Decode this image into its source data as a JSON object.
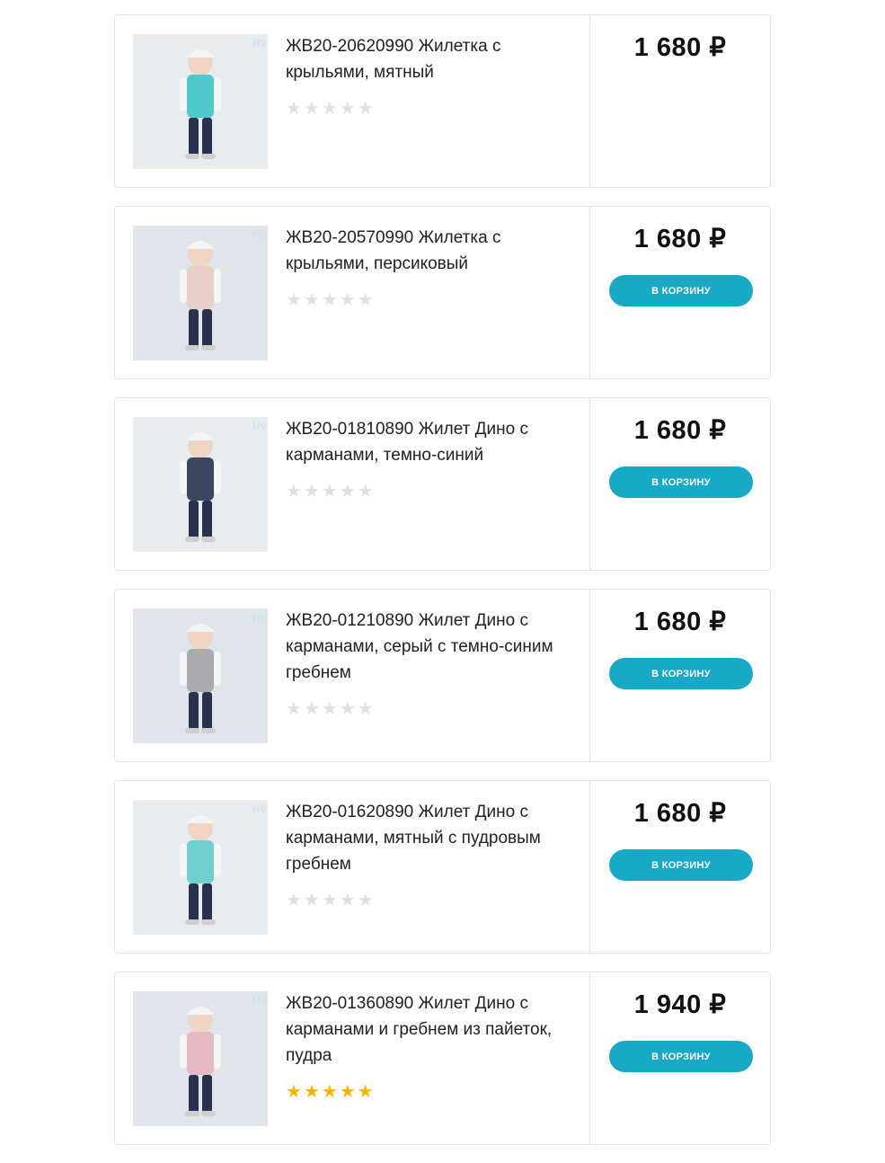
{
  "products": [
    {
      "title": "ЖВ20-20620990 Жилетка с крыльями, мятный",
      "price": "1 680 ₽",
      "rating": 0,
      "has_cart": false,
      "vest_color": "#4fc9cc",
      "image_theme": "mint-winged-vest"
    },
    {
      "title": "ЖВ20-20570990 Жилетка с крыльями, персиковый",
      "price": "1 680 ₽",
      "rating": 0,
      "has_cart": true,
      "cart_label": "В КОРЗИНУ",
      "vest_color": "#e9cfc7",
      "image_theme": "peach-winged-vest"
    },
    {
      "title": "ЖВ20-01810890 Жилет Дино с карманами, темно-синий",
      "price": "1 680 ₽",
      "rating": 0,
      "has_cart": true,
      "cart_label": "В КОРЗИНУ",
      "vest_color": "#3b4660",
      "image_theme": "navy-dino-vest"
    },
    {
      "title": "ЖВ20-01210890 Жилет Дино с карманами, серый с темно-синим гребнем",
      "price": "1 680 ₽",
      "rating": 0,
      "has_cart": true,
      "cart_label": "В КОРЗИНУ",
      "vest_color": "#a9abae",
      "image_theme": "grey-dino-vest"
    },
    {
      "title": "ЖВ20-01620890 Жилет Дино с карманами, мятный с пудровым гребнем",
      "price": "1 680 ₽",
      "rating": 0,
      "has_cart": true,
      "cart_label": "В КОРЗИНУ",
      "vest_color": "#6fd0cf",
      "image_theme": "mint-dino-vest"
    },
    {
      "title": "ЖВ20-01360890 Жилет Дино с карманами и гребнем из пайеток, пудра",
      "price": "1 940 ₽",
      "rating": 5,
      "has_cart": true,
      "cart_label": "В КОРЗИНУ",
      "vest_color": "#e7b9c4",
      "image_theme": "powder-sequin-dino-vest"
    }
  ],
  "colors": {
    "accent": "#17a9c6",
    "star_on": "#f7b500",
    "star_off": "#e0e0e0",
    "border": "#e3e3e3"
  }
}
